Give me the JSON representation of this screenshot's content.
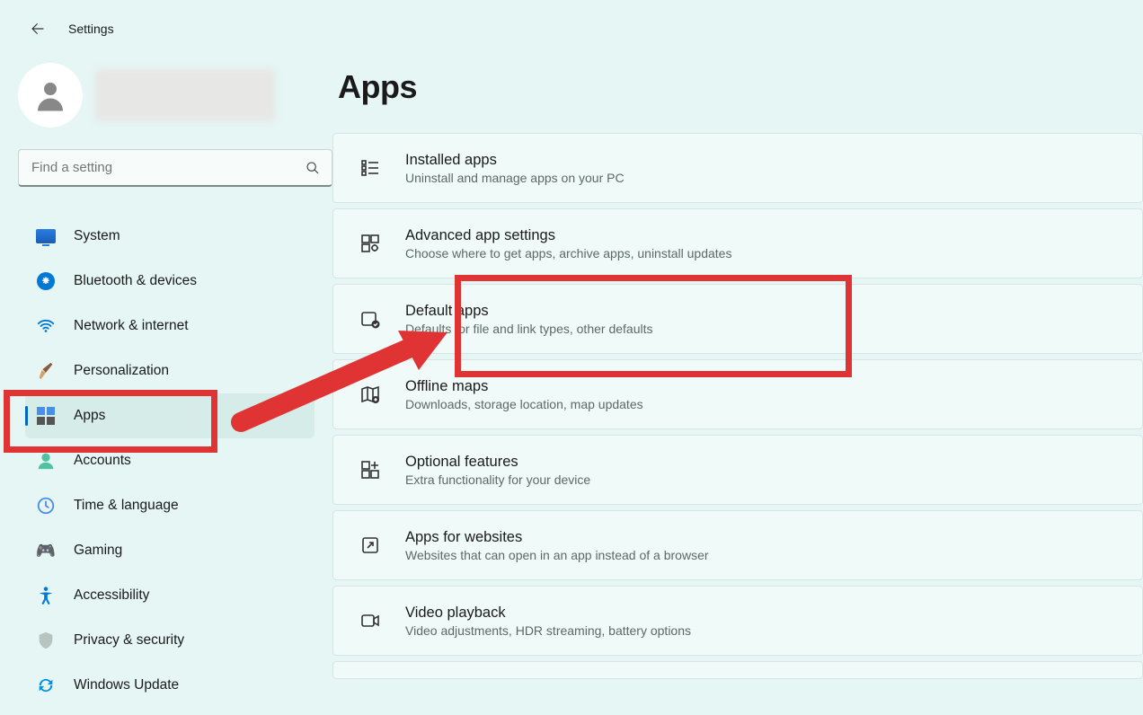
{
  "header": {
    "title": "Settings"
  },
  "search": {
    "placeholder": "Find a setting"
  },
  "nav": {
    "items": [
      {
        "label": "System"
      },
      {
        "label": "Bluetooth & devices"
      },
      {
        "label": "Network & internet"
      },
      {
        "label": "Personalization"
      },
      {
        "label": "Apps"
      },
      {
        "label": "Accounts"
      },
      {
        "label": "Time & language"
      },
      {
        "label": "Gaming"
      },
      {
        "label": "Accessibility"
      },
      {
        "label": "Privacy & security"
      },
      {
        "label": "Windows Update"
      }
    ]
  },
  "main": {
    "title": "Apps",
    "cards": [
      {
        "title": "Installed apps",
        "desc": "Uninstall and manage apps on your PC"
      },
      {
        "title": "Advanced app settings",
        "desc": "Choose where to get apps, archive apps, uninstall updates"
      },
      {
        "title": "Default apps",
        "desc": "Defaults for file and link types, other defaults"
      },
      {
        "title": "Offline maps",
        "desc": "Downloads, storage location, map updates"
      },
      {
        "title": "Optional features",
        "desc": "Extra functionality for your device"
      },
      {
        "title": "Apps for websites",
        "desc": "Websites that can open in an app instead of a browser"
      },
      {
        "title": "Video playback",
        "desc": "Video adjustments, HDR streaming, battery options"
      }
    ]
  }
}
